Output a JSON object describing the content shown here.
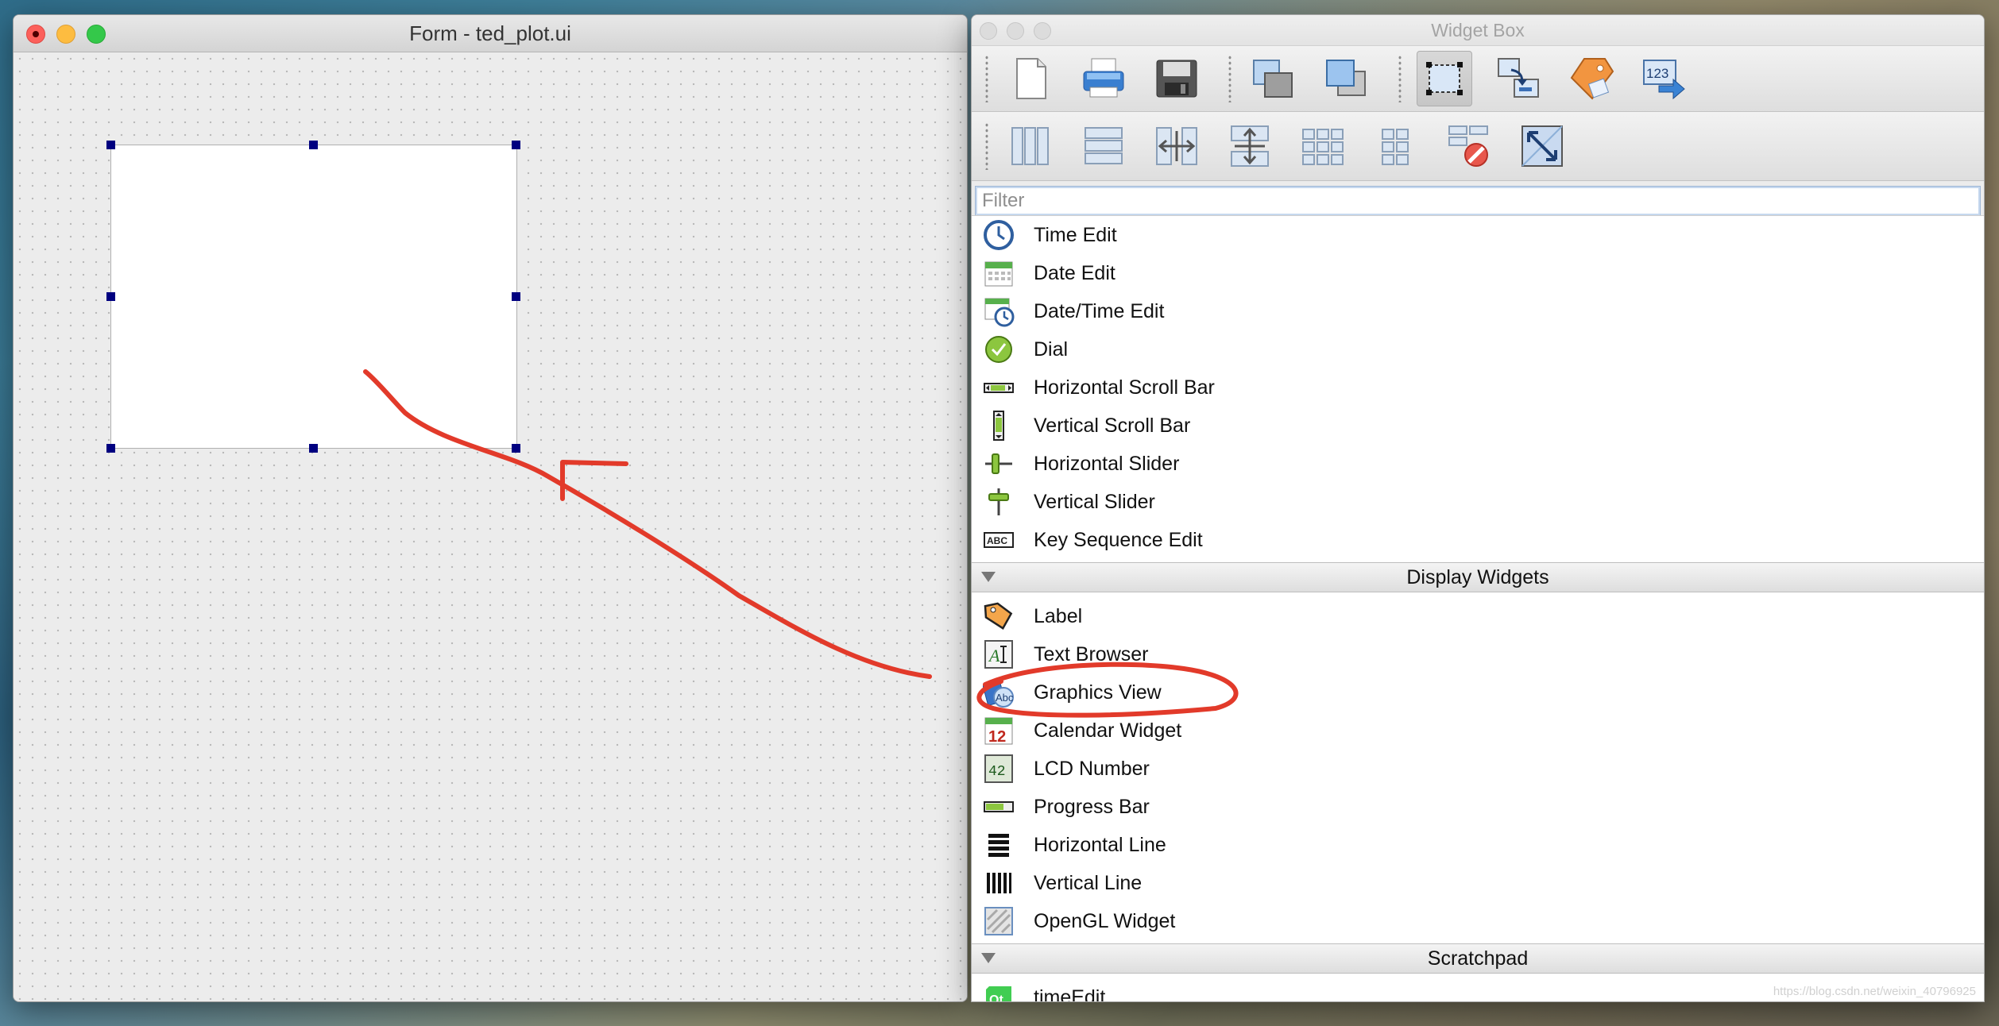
{
  "form_window": {
    "title": "Form - ted_plot.ui"
  },
  "widget_box": {
    "title": "Widget Box",
    "filter_placeholder": "Filter",
    "toolbar1": [
      "new-file-icon",
      "print-icon",
      "save-icon",
      "send-to-back-icon",
      "bring-to-front-icon",
      "edit-widgets-icon",
      "edit-signals-icon",
      "edit-buddies-icon",
      "edit-tab-order-icon"
    ],
    "toolbar2": [
      "layout-horizontal-icon",
      "layout-vertical-icon",
      "splitter-horizontal-icon",
      "splitter-vertical-icon",
      "layout-grid-icon",
      "layout-form-icon",
      "break-layout-icon",
      "adjust-size-icon"
    ],
    "items_top": [
      {
        "label": "Time Edit",
        "icon": "clock-icon"
      },
      {
        "label": "Date Edit",
        "icon": "calendar-icon"
      },
      {
        "label": "Date/Time Edit",
        "icon": "calendar-clock-icon"
      },
      {
        "label": "Dial",
        "icon": "dial-icon"
      },
      {
        "label": "Horizontal Scroll Bar",
        "icon": "hscroll-icon"
      },
      {
        "label": "Vertical Scroll Bar",
        "icon": "vscroll-icon"
      },
      {
        "label": "Horizontal Slider",
        "icon": "hslider-icon"
      },
      {
        "label": "Vertical Slider",
        "icon": "vslider-icon"
      },
      {
        "label": "Key Sequence Edit",
        "icon": "key-sequence-icon"
      }
    ],
    "category_display": "Display Widgets",
    "items_display": [
      {
        "label": "Label",
        "icon": "tag-icon"
      },
      {
        "label": "Text Browser",
        "icon": "text-browser-icon"
      },
      {
        "label": "Graphics View",
        "icon": "graphics-view-icon"
      },
      {
        "label": "Calendar Widget",
        "icon": "calendar-widget-icon"
      },
      {
        "label": "LCD Number",
        "icon": "lcd-icon"
      },
      {
        "label": "Progress Bar",
        "icon": "progress-icon"
      },
      {
        "label": "Horizontal Line",
        "icon": "hline-icon"
      },
      {
        "label": "Vertical Line",
        "icon": "vline-icon"
      },
      {
        "label": "OpenGL Widget",
        "icon": "opengl-icon"
      }
    ],
    "category_scratch": "Scratchpad",
    "items_scratch": [
      {
        "label": "timeEdit",
        "icon": "qt-icon"
      }
    ],
    "calendar_day": "12",
    "lcd_digits": "42",
    "qt_text": "Qt",
    "abc_text": "ABC",
    "counter_text": "123"
  },
  "watermark": "https://blog.csdn.net/weixin_40796925"
}
